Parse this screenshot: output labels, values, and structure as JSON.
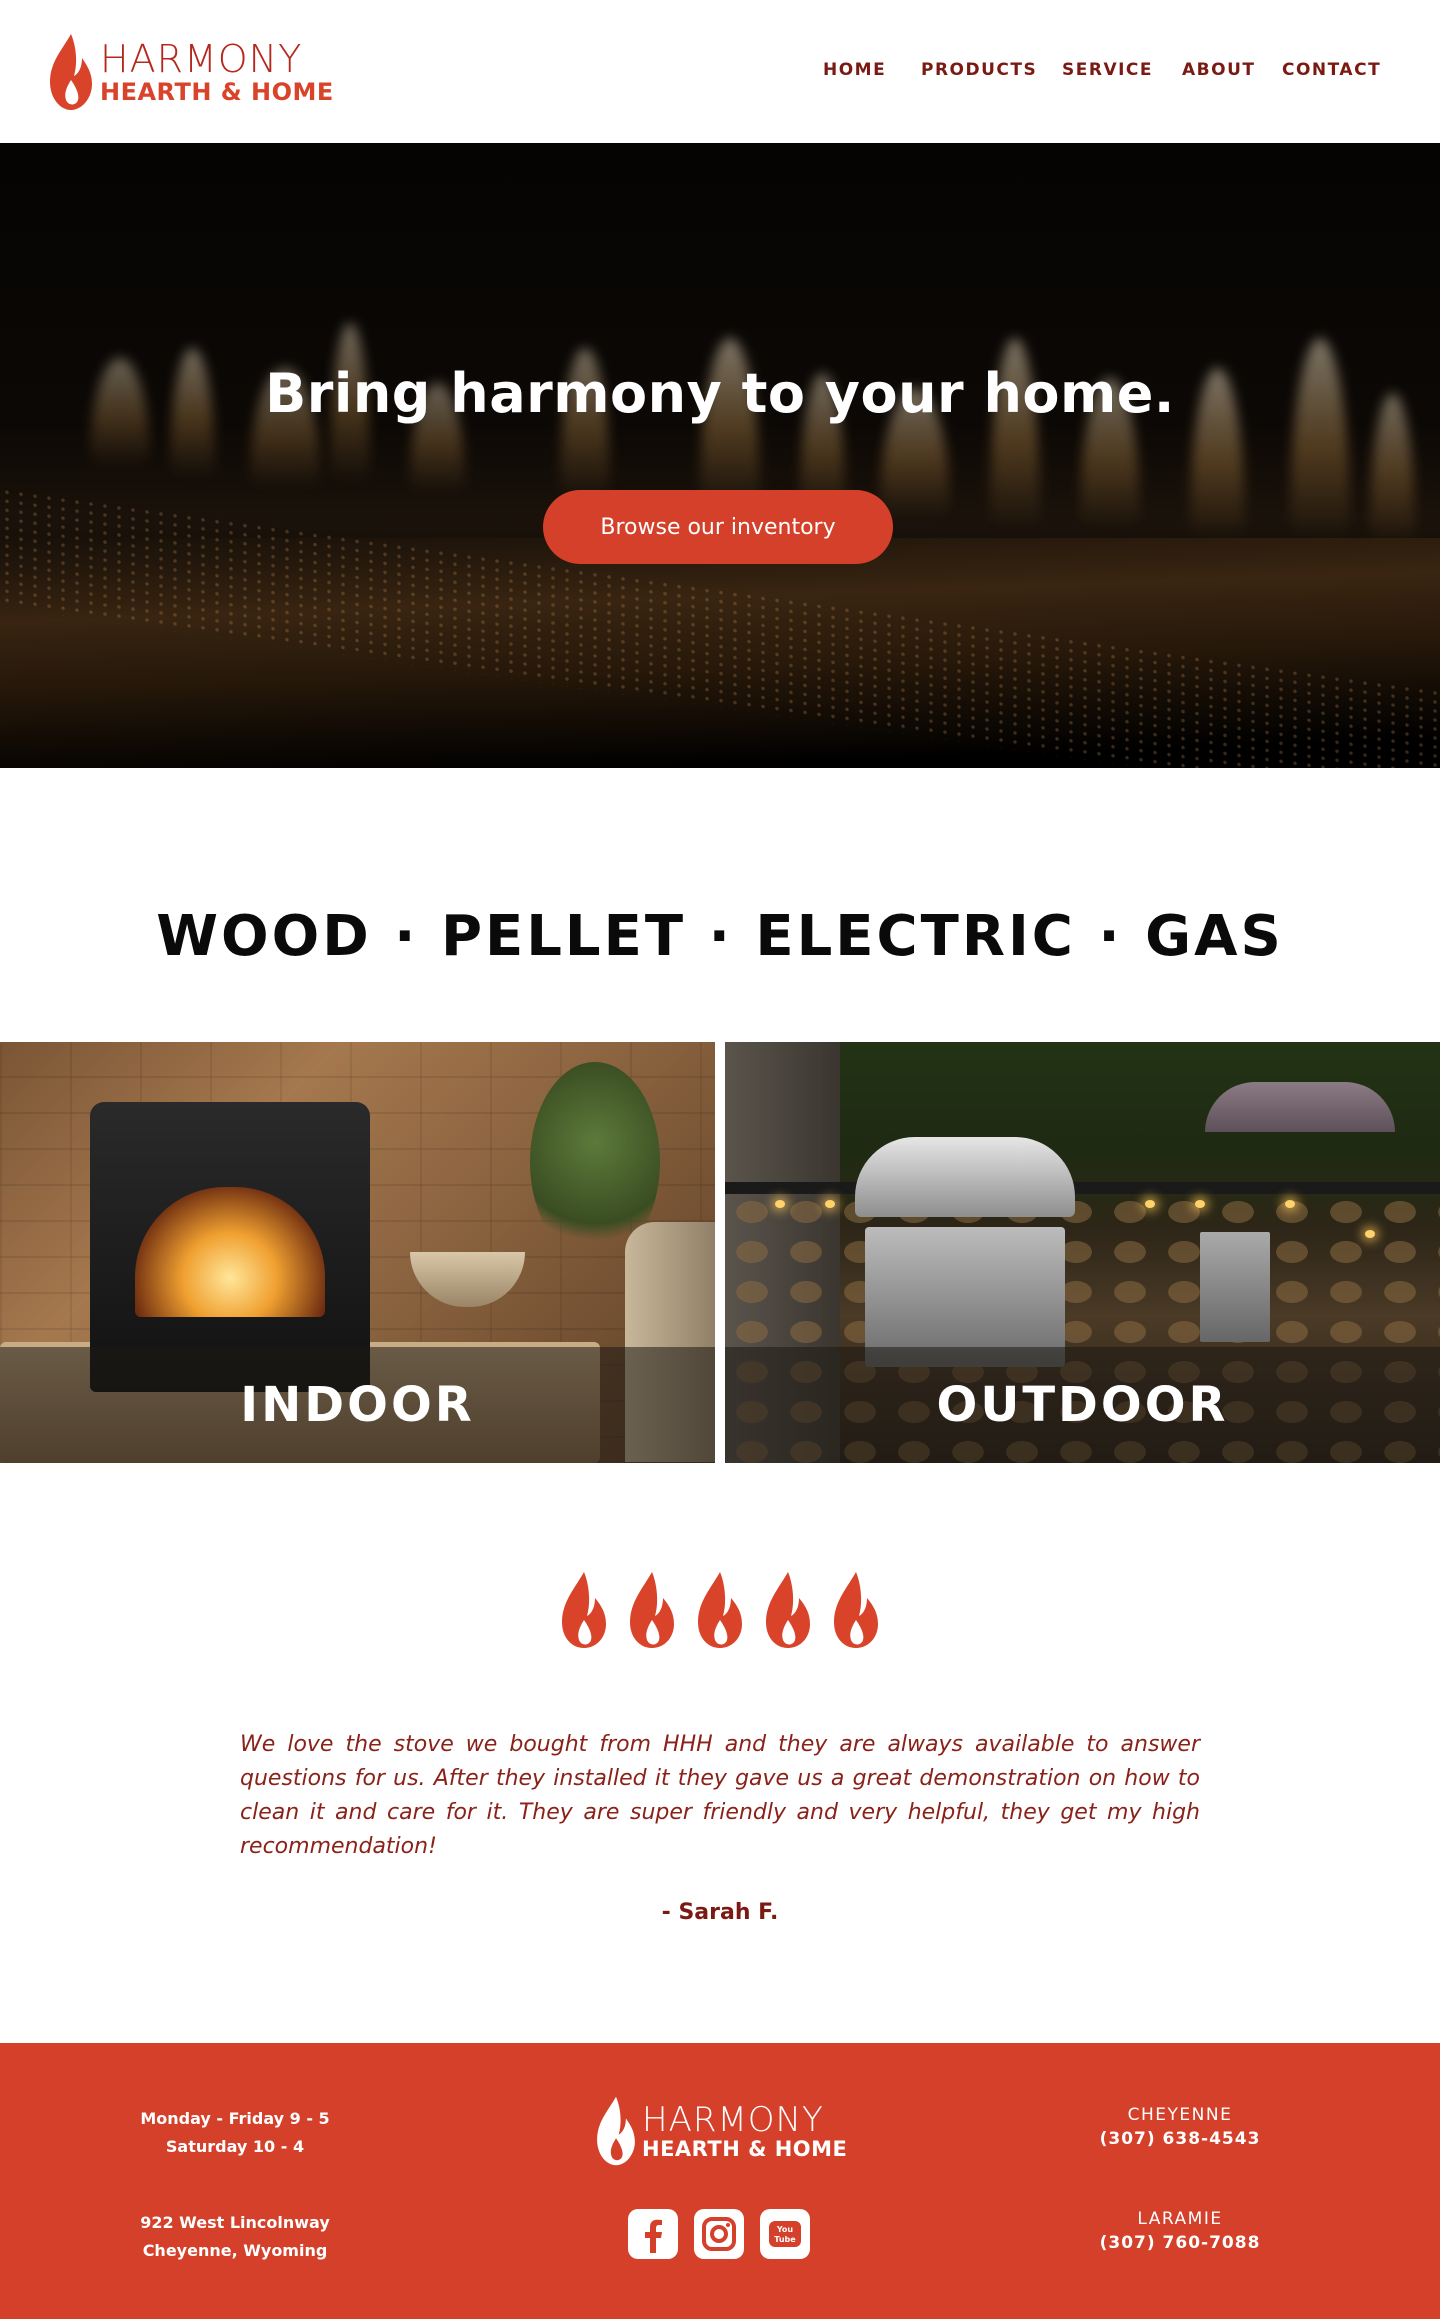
{
  "header": {
    "logo_line1": "HARMONY",
    "logo_line2": "HEARTH & HOME",
    "nav": [
      {
        "label": "HOME"
      },
      {
        "label": "PRODUCTS"
      },
      {
        "label": "SERVICE"
      },
      {
        "label": "ABOUT"
      },
      {
        "label": "CONTACT"
      }
    ]
  },
  "hero": {
    "title": "Bring harmony to your home.",
    "button_label": "Browse our inventory"
  },
  "fuel": {
    "title": "WOOD · PELLET · ELECTRIC · GAS"
  },
  "tiles": {
    "indoor_label": "INDOOR",
    "outdoor_label": "OUTDOOR"
  },
  "rating": {
    "value": 5,
    "max": 5,
    "icon": "flame-icon"
  },
  "testimonial": {
    "quote": "We love the stove we bought from HHH and they are always available to answer questions for us. After they installed it they gave us a great demonstration on how to clean it and care for it. They are super friendly and very helpful, they get my high recommendation!",
    "author": "- Sarah F."
  },
  "footer": {
    "hours_line1": "Monday - Friday 9 - 5",
    "hours_line2": "Saturday 10 - 4",
    "address_line1": "922 West Lincolnway",
    "address_line2": "Cheyenne, Wyoming",
    "logo_line1": "HARMONY",
    "logo_line2": "HEARTH & HOME",
    "locations": [
      {
        "city": "CHEYENNE",
        "phone": "(307) 638-4543"
      },
      {
        "city": "LARAMIE",
        "phone": "(307) 760-7088"
      }
    ],
    "social": [
      {
        "icon": "facebook-icon"
      },
      {
        "icon": "instagram-icon"
      },
      {
        "icon": "youtube-icon"
      }
    ]
  },
  "colors": {
    "brand_red": "#d4402a",
    "brand_dark_red": "#7a1a12",
    "text_dark": "#0a0a0a"
  }
}
